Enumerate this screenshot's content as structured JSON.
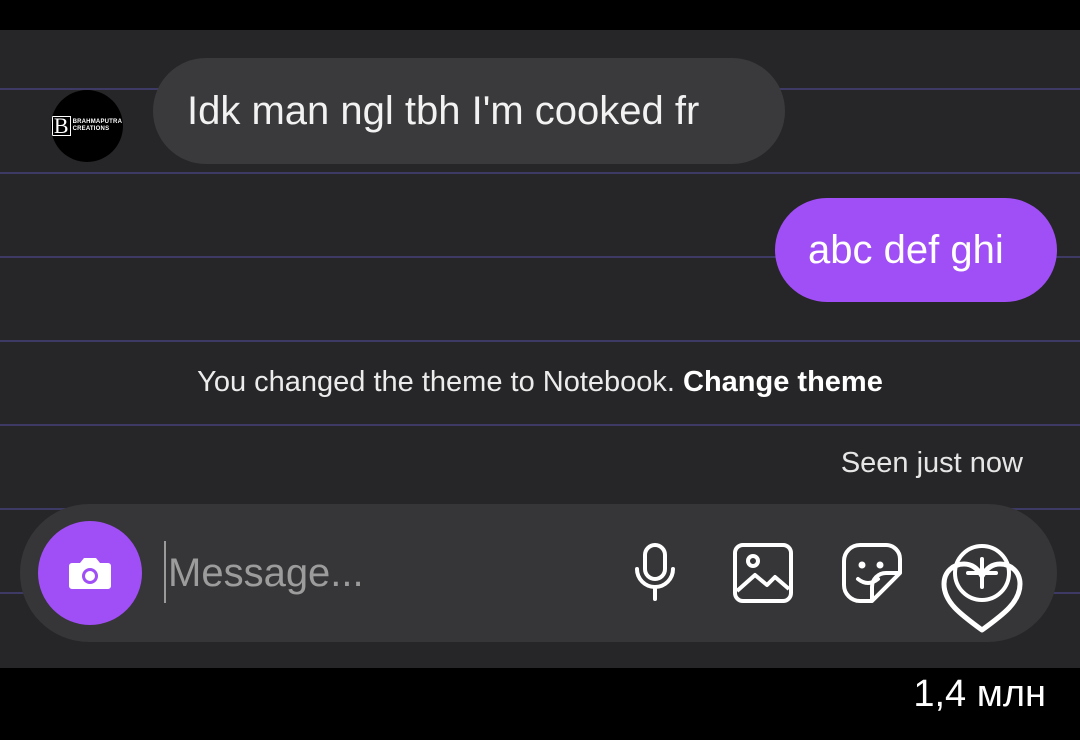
{
  "avatar": {
    "logo_letter": "B",
    "logo_line1": "BRAHMAPUTRA",
    "logo_line2": "CREATIONS"
  },
  "messages": [
    {
      "direction": "incoming",
      "text": "Idk man ngl tbh I'm cooked fr"
    },
    {
      "direction": "outgoing",
      "text": "abc def ghi"
    }
  ],
  "system_notice": {
    "text": "You changed the theme to Notebook.",
    "action_label": "Change theme"
  },
  "status": {
    "seen_label": "Seen just now"
  },
  "composer": {
    "placeholder": "Message...",
    "value": "",
    "icons": [
      "camera-icon",
      "microphone-icon",
      "gallery-icon",
      "sticker-icon",
      "add-icon"
    ]
  },
  "overlay": {
    "like_icon": "heart-outline-icon",
    "like_count": "1,4 млн"
  },
  "colors": {
    "accent": "#a04ef6",
    "background": "#262628",
    "incoming_bubble": "#3a3a3c",
    "notebook_lines": "#3d3a66"
  }
}
